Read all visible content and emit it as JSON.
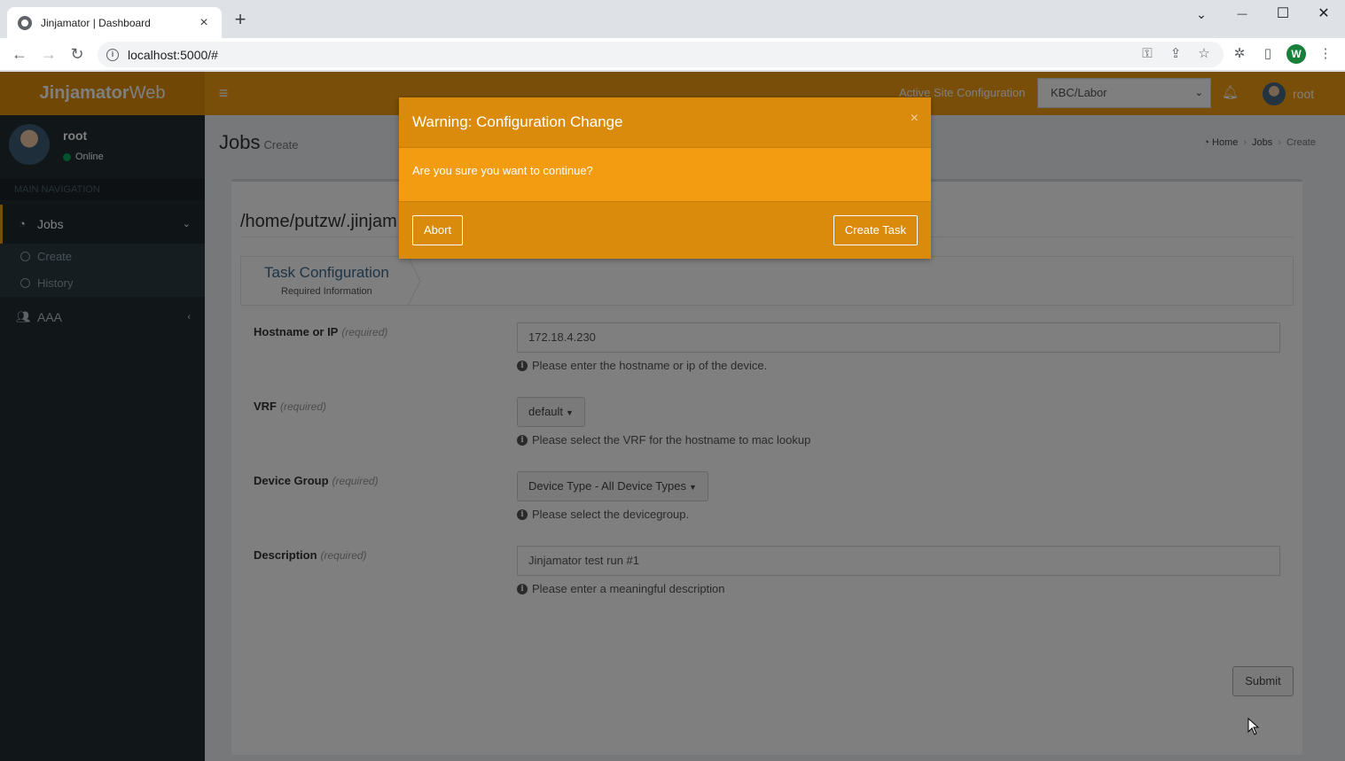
{
  "browser": {
    "tab_title": "Jinjamator | Dashboard",
    "tab_close": "×",
    "new_tab": "+",
    "url": "localhost:5000/#",
    "profile_initial": "W",
    "window_controls": {
      "chevron": "⌄",
      "minimize": "—",
      "maximize": "☐",
      "close": "✕"
    }
  },
  "app": {
    "brand_bold": "Jinjamator",
    "brand_rest": "Web",
    "site_label": "Active Site Configuration",
    "site_selected": "KBC/Labor",
    "header_user": "root",
    "accent_color": "#f39c12"
  },
  "sidebar": {
    "user_name": "root",
    "user_status": "Online",
    "nav_header": "MAIN NAVIGATION",
    "items": [
      {
        "label": "Jobs",
        "icon": "dashboard-icon"
      },
      {
        "label": "AAA",
        "icon": "users-icon"
      }
    ],
    "sub_items": [
      {
        "label": "Create"
      },
      {
        "label": "History"
      }
    ]
  },
  "page": {
    "title": "Jobs",
    "subtitle": "Create",
    "breadcrumb": [
      "Home",
      "Jobs",
      "Create"
    ],
    "task_path": "/home/putzw/.jinjam",
    "step_title": "Task Configuration",
    "step_subtitle": "Required Information",
    "required_text": "(required)",
    "fields": {
      "hostname": {
        "label": "Hostname or IP",
        "value": "172.18.4.230",
        "help": "Please enter the hostname or ip of the device."
      },
      "vrf": {
        "label": "VRF",
        "value": "default",
        "help": "Please select the VRF for the hostname to mac lookup"
      },
      "device_group": {
        "label": "Device Group",
        "value": "Device Type - All Device Types",
        "help": "Please select the devicegroup."
      },
      "description": {
        "label": "Description",
        "value": "Jinjamator test run #1",
        "help": "Please enter a meaningful description"
      }
    },
    "submit_label": "Submit"
  },
  "modal": {
    "title": "Warning: Configuration Change",
    "close": "×",
    "body": "Are you sure you want to continue?",
    "abort_label": "Abort",
    "confirm_label": "Create Task"
  }
}
